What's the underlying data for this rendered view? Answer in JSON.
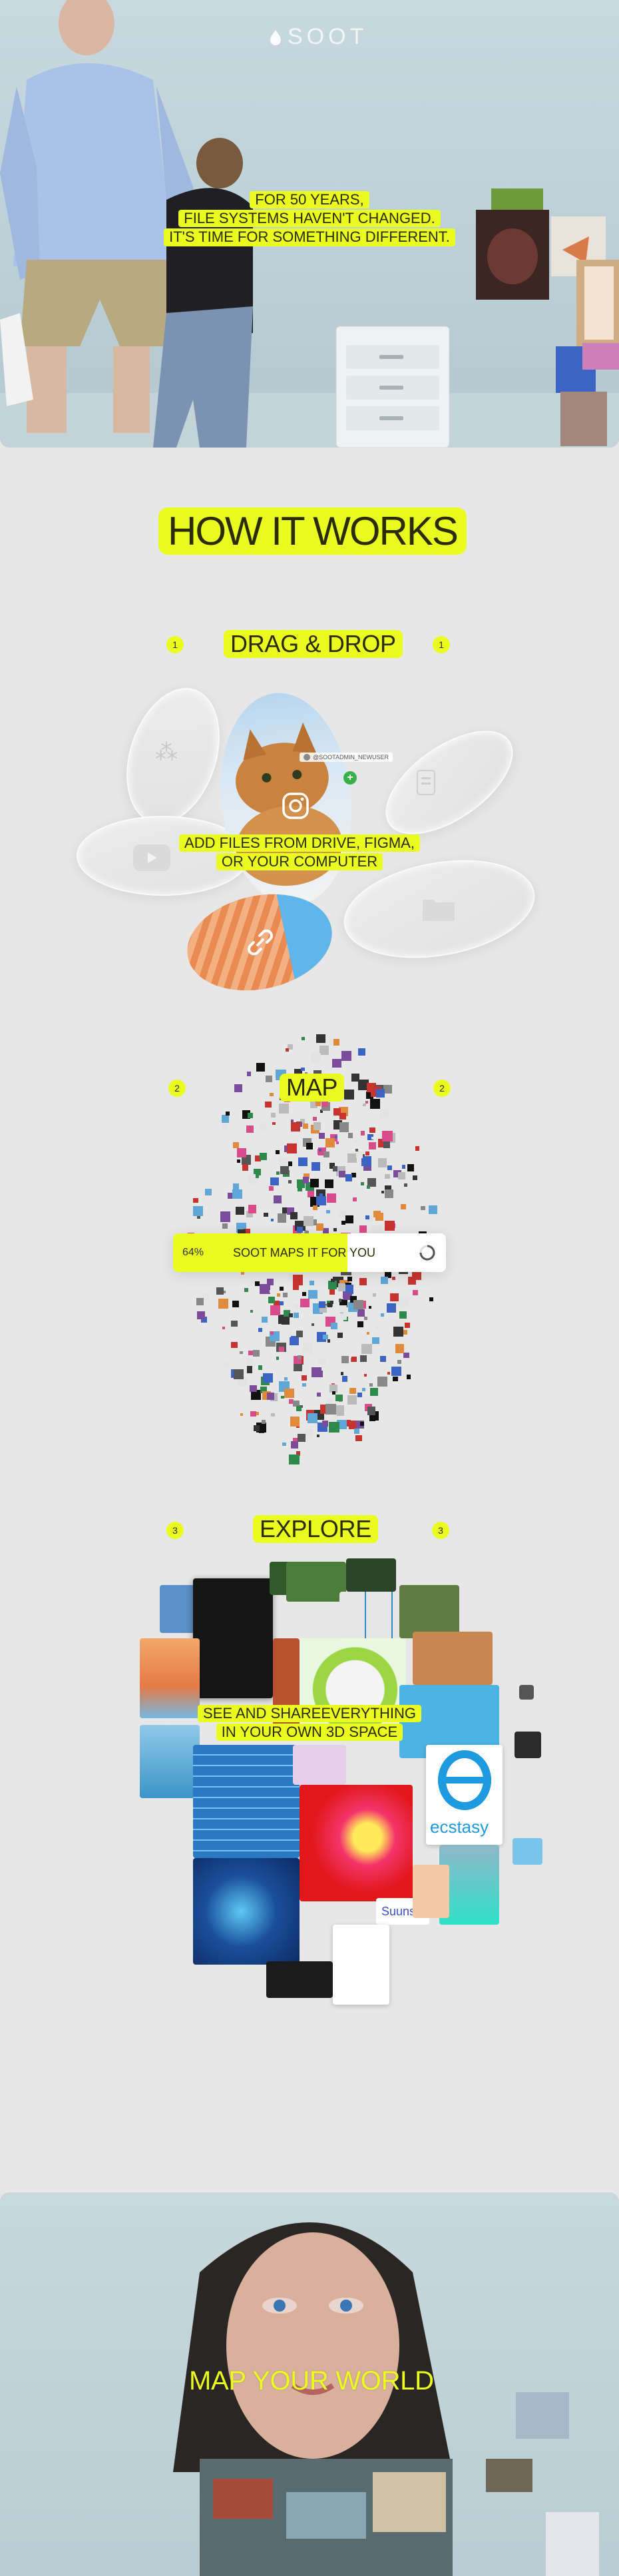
{
  "brand": {
    "name": "SOOT"
  },
  "hero": {
    "lines": [
      "FOR 50 YEARS,",
      "FILE SYSTEMS HAVEN'T CHANGED.",
      "IT'S TIME FOR SOMETHING DIFFERENT."
    ]
  },
  "how": {
    "title": "HOW IT WORKS"
  },
  "step1": {
    "num": "1",
    "title": "DRAG & DROP",
    "handle": "@SOOTADMIN_NEWUSER",
    "lines": [
      "ADD FILES FROM DRIVE, FIGMA,",
      "OR YOUR COMPUTER"
    ]
  },
  "step2": {
    "num": "2",
    "title": "MAP",
    "progress": "64%",
    "progress_value": 0.64,
    "status": "SOOT MAPS IT FOR YOU"
  },
  "step3": {
    "num": "3",
    "title": "EXPLORE",
    "lines": [
      "SEE AND SHAREEVERYTHING",
      "IN YOUR OWN 3D SPACE"
    ],
    "tile_text": [
      "ecstasy",
      "Suuns"
    ]
  },
  "footer": {
    "title": "MAP YOUR WORLD"
  },
  "colors": {
    "accent": "#e9fb1f",
    "bg": "#e7e7e7"
  }
}
